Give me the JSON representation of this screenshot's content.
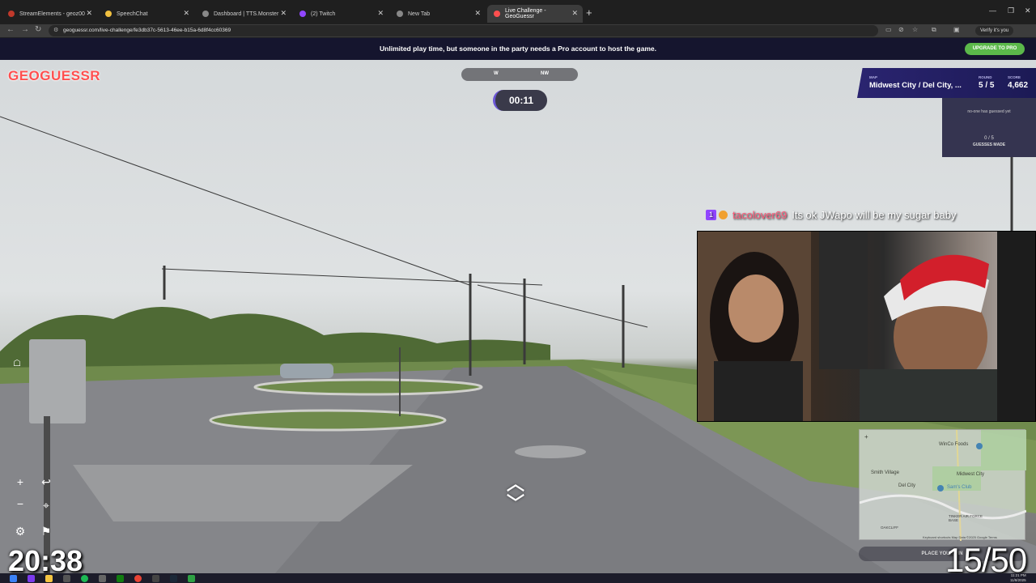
{
  "browser": {
    "tabs": [
      {
        "label": "StreamElements - geoz00",
        "color": "#c0392b"
      },
      {
        "label": "SpeechChat",
        "color": "#f0c040"
      },
      {
        "label": "Dashboard | TTS.Monster",
        "color": "#888888"
      },
      {
        "label": "(2) Twitch",
        "color": "#9146ff"
      },
      {
        "label": "New Tab",
        "color": "#888888"
      },
      {
        "label": "Live Challenge - GeoGuessr",
        "color": "#ff4f4f"
      }
    ],
    "url": "geoguessr.com/live-challenge/fe3db37c-5613-46ee-b15a-6d8f4cc60369",
    "profile_label": "Verify it's you"
  },
  "banner": {
    "text": "Unlimited play time, but someone in the party needs a Pro account to host the game.",
    "button": "UPGRADE TO PRO"
  },
  "game": {
    "logo": "GEOGUESSR",
    "compass": {
      "w": "W",
      "nw": "NW"
    },
    "timer": "00:11",
    "map_label": "MAP",
    "map_value": "Midwest City / Del City, ...",
    "round_label": "ROUND",
    "round_value": "5 / 5",
    "score_label": "SCORE",
    "score_value": "4,662",
    "guess_note": "no-one has guessed yet",
    "guesses_count": "0 / 5",
    "guesses_label": "GUESSES MADE",
    "place_pin": "PLACE YOUR PIN"
  },
  "minimap": {
    "labels": [
      "WinCo Foods",
      "Smith Village",
      "Midwest City",
      "Del City",
      "Sam's Club",
      "TINKER AIR FORCE BASE",
      "OAKCLIFF"
    ],
    "footer": "Keyboard shortcuts   Map Data ©2025 Google   Terms"
  },
  "chat": {
    "user": "tacolover69",
    "message": "Its ok JWapo will be my sugar baby"
  },
  "overlay": {
    "clock": "20:38",
    "counter": "15/50"
  },
  "taskbar": {
    "time": "11:21 PM",
    "date": "11/8/2025"
  },
  "colors": {
    "banner_bg": "#15152e",
    "upgrade_green": "#5bb84a",
    "status_purple": "#2a2470",
    "logo_red": "#ff4f4f"
  }
}
